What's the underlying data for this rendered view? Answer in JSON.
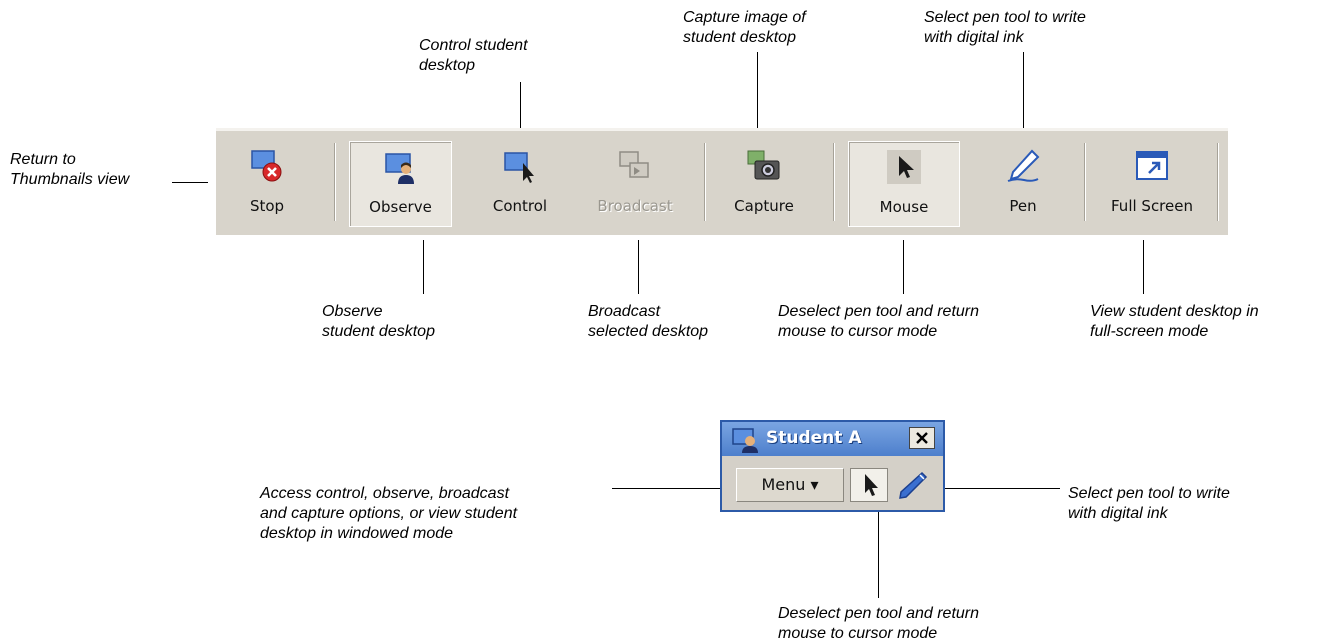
{
  "toolbar": {
    "stop": "Stop",
    "observe": "Observe",
    "control": "Control",
    "broadcast": "Broadcast",
    "capture": "Capture",
    "mouse": "Mouse",
    "pen": "Pen",
    "full_screen": "Full Screen"
  },
  "student_window": {
    "title": "Student A",
    "menu_label": "Menu",
    "menu_arrow": "▾"
  },
  "callouts": {
    "stop": "Return to\nThumbnails view",
    "control": "Control student\ndesktop",
    "capture": "Capture image of\nstudent desktop",
    "pen_top": "Select pen tool to write\nwith digital ink",
    "observe": "Observe\nstudent desktop",
    "broadcast": "Broadcast\nselected desktop",
    "mouse": "Deselect pen tool and return\nmouse to cursor mode",
    "full_screen": "View student desktop in\nfull-screen mode",
    "menu": "Access control, observe, broadcast\nand capture options, or view student\ndesktop in windowed mode",
    "pen_bottom": "Select pen tool to write\nwith digital ink",
    "cursor_bottom": "Deselect pen tool and return\nmouse to cursor mode"
  },
  "colors": {
    "toolbar_bg": "#d8d4cb",
    "title_bar": "#4d7fcc",
    "stop_red": "#d8282a"
  }
}
